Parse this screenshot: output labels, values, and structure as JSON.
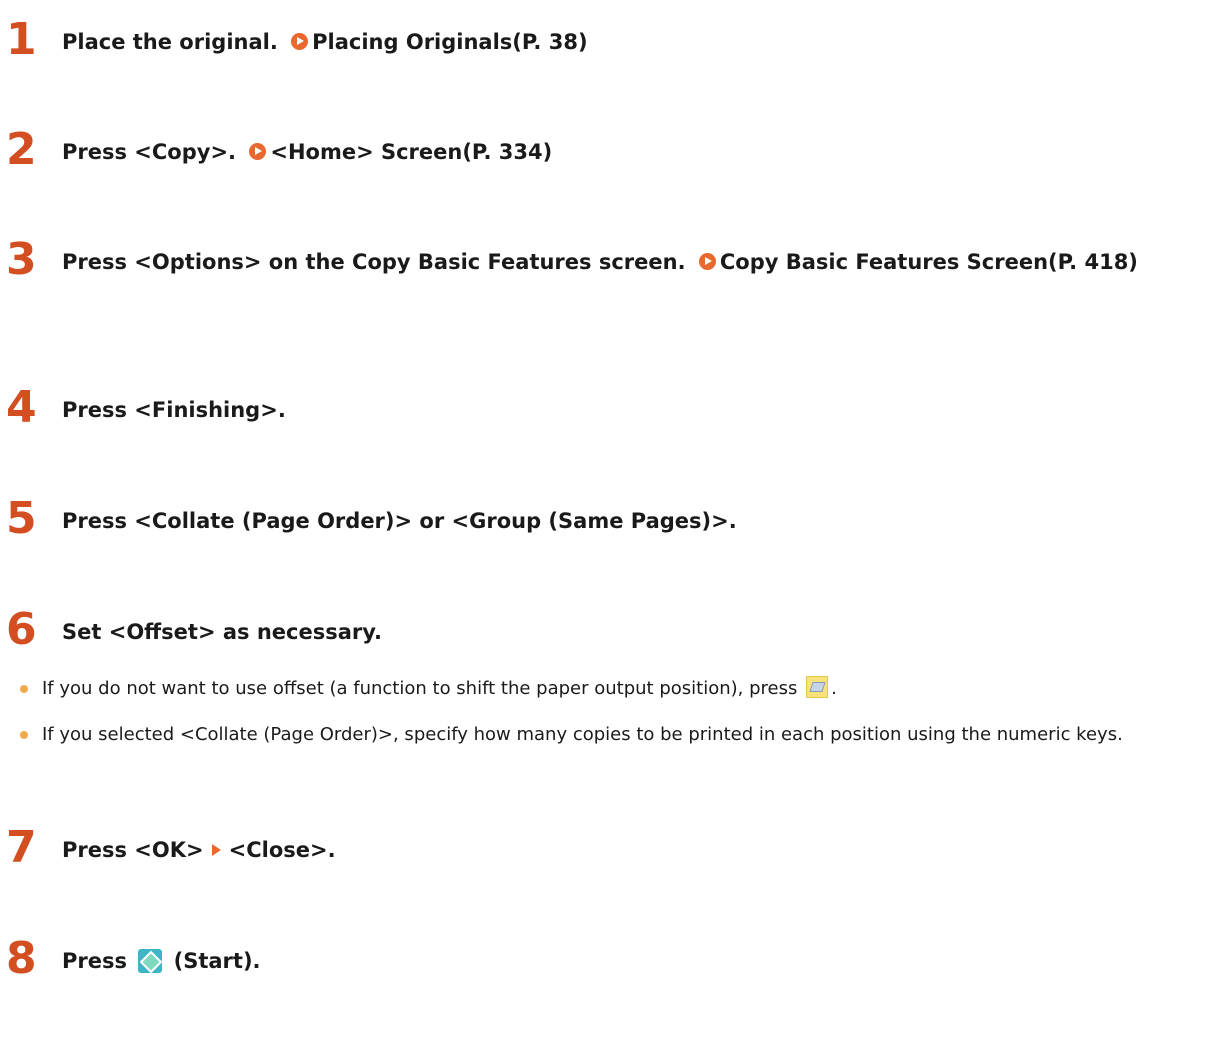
{
  "steps": [
    {
      "number": "1",
      "text": "Place the original.",
      "link": "Placing Originals(P. 38)"
    },
    {
      "number": "2",
      "text": "Press <Copy>.",
      "link": "<Home> Screen(P. 334)"
    },
    {
      "number": "3",
      "text": "Press <Options> on the Copy Basic Features screen.",
      "link": "Copy Basic Features Screen(P. 418)"
    },
    {
      "number": "4",
      "text": "Press <Finishing>."
    },
    {
      "number": "5",
      "text": "Press <Collate (Page Order)> or <Group (Same Pages)>."
    },
    {
      "number": "6",
      "text": "Set <Offset> as necessary."
    },
    {
      "number": "7",
      "text_a": "Press <OK>",
      "text_b": "<Close>."
    },
    {
      "number": "8",
      "text_a": "Press",
      "text_b": "(Start)."
    }
  ],
  "bullets": [
    {
      "text": "If you do not want to use offset (a function to shift the paper output position), press",
      "after": "."
    },
    {
      "text": "If you selected <Collate (Page Order)>, specify how many copies to be printed in each position using the numeric keys."
    }
  ],
  "icons": {
    "link_arrow": "orange-circle-arrow-icon",
    "offset_off": "paper-offset-icon",
    "step_arrow": "orange-triangle-icon",
    "start": "start-key-icon"
  },
  "colors": {
    "step_number": "#d34f21",
    "link_icon": "#e8682d",
    "bullet": "#f0a94f",
    "start_key": "#3cb6c4"
  }
}
